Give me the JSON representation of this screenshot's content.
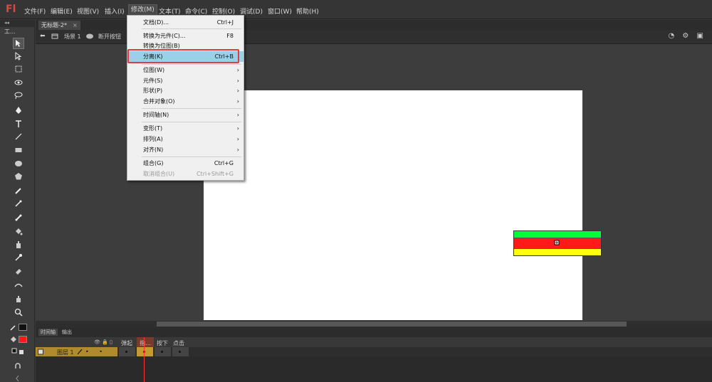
{
  "app": {
    "logo": "Fl"
  },
  "menubar": {
    "items": [
      "文件(F)",
      "编辑(E)",
      "视图(V)",
      "插入(I)",
      "修改(M)",
      "文本(T)",
      "命令(C)",
      "控制(O)",
      "调试(D)",
      "窗口(W)",
      "帮助(H)"
    ],
    "active_index": 4
  },
  "toolpanel": {
    "header": "◂◂",
    "label": "工..."
  },
  "document": {
    "tab_title": "无标题-2*",
    "tab_close": "×"
  },
  "editbar": {
    "back": "⬅",
    "scene_label": "场景 1",
    "symbol_label": "断开按钮",
    "right_icons": "◔ ⚙ ▣"
  },
  "dropdown": {
    "items": [
      {
        "label": "文档(D)...",
        "shortcut": "Ctrl+J",
        "submenu": false,
        "disabled": false
      },
      {
        "sep": true
      },
      {
        "label": "转换为元件(C)...",
        "shortcut": "F8",
        "submenu": false,
        "disabled": false
      },
      {
        "label": "转换为位图(B)",
        "shortcut": "",
        "submenu": false,
        "disabled": false
      },
      {
        "label": "分离(K)",
        "shortcut": "Ctrl+B",
        "submenu": false,
        "disabled": false,
        "highlight": true
      },
      {
        "sep": true
      },
      {
        "label": "位图(W)",
        "shortcut": "",
        "submenu": true,
        "disabled": false
      },
      {
        "label": "元件(S)",
        "shortcut": "",
        "submenu": true,
        "disabled": false
      },
      {
        "label": "形状(P)",
        "shortcut": "",
        "submenu": true,
        "disabled": false
      },
      {
        "label": "合并对象(O)",
        "shortcut": "",
        "submenu": true,
        "disabled": false
      },
      {
        "sep": true
      },
      {
        "label": "时间轴(N)",
        "shortcut": "",
        "submenu": true,
        "disabled": false
      },
      {
        "sep": true
      },
      {
        "label": "变形(T)",
        "shortcut": "",
        "submenu": true,
        "disabled": false
      },
      {
        "label": "排列(A)",
        "shortcut": "",
        "submenu": true,
        "disabled": false
      },
      {
        "label": "对齐(N)",
        "shortcut": "",
        "submenu": true,
        "disabled": false
      },
      {
        "sep": true
      },
      {
        "label": "组合(G)",
        "shortcut": "Ctrl+G",
        "submenu": false,
        "disabled": false
      },
      {
        "label": "取消组合(U)",
        "shortcut": "Ctrl+Shift+G",
        "submenu": false,
        "disabled": true
      }
    ],
    "submenu_arrow": "›"
  },
  "stage": {
    "bar_colors": [
      "#00ff33",
      "#ff1a1a",
      "#ffff11"
    ]
  },
  "timeline": {
    "tabs": [
      "时间轴",
      "输出"
    ],
    "header_icons": [
      "👁",
      "🔒",
      "▯"
    ],
    "frame_labels": [
      "弹起",
      "指...",
      "按下",
      "点击"
    ],
    "layer_name": "图层 1",
    "layer_dots": "• • •"
  }
}
